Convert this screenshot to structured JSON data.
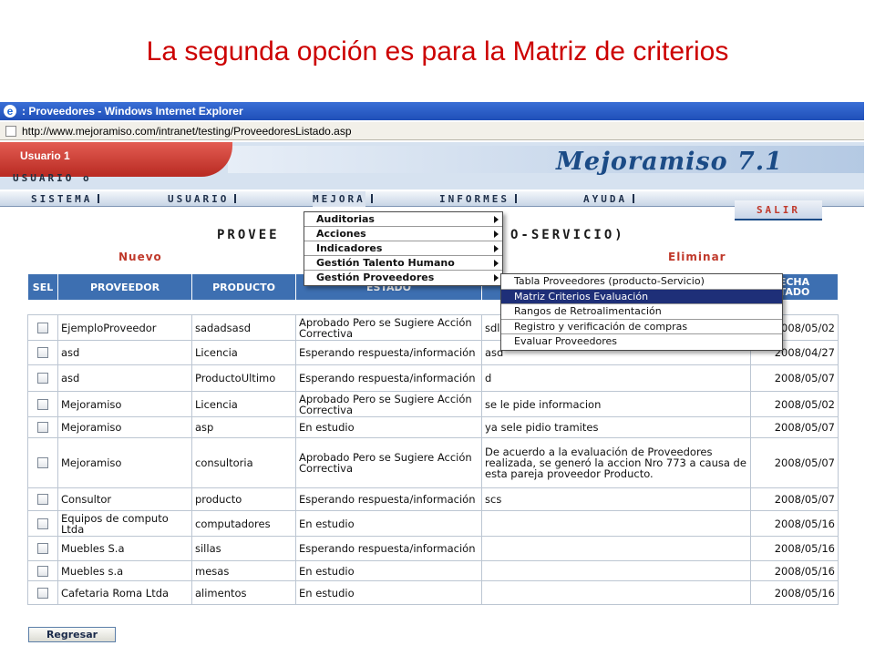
{
  "slide": {
    "title": "La segunda opción es para la Matriz de criterios"
  },
  "browser": {
    "title": ": Proveedores - Windows Internet Explorer",
    "url": "http://www.mejoramiso.com/intranet/testing/ProveedoresListado.asp"
  },
  "app": {
    "user_name": "Usuario 1",
    "user_role": "USUARIO o",
    "brand": "Mejoramiso 7.1",
    "menu": [
      "SISTEMA",
      "USUARIO",
      "MEJORA",
      "INFORMES",
      "AYUDA"
    ],
    "salir": "SALIR"
  },
  "page": {
    "heading_left": "PROVEE",
    "heading_right": "O-SERVICIO)",
    "nuevo": "Nuevo",
    "eliminar": "Eliminar",
    "back_button": "Regresar"
  },
  "dropdown": [
    {
      "label": "Auditorias"
    },
    {
      "label": "Acciones"
    },
    {
      "label": "Indicadores"
    },
    {
      "label": "Gestión Talento Humano"
    },
    {
      "label": "Gestión Proveedores"
    }
  ],
  "submenu": [
    {
      "label": "Tabla Proveedores (producto-Servicio)"
    },
    {
      "label": "Matriz Criterios Evaluación"
    },
    {
      "label": "Rangos de Retroalimentación"
    },
    {
      "label": "Registro y verificación de compras"
    },
    {
      "label": "Evaluar Proveedores"
    }
  ],
  "table": {
    "headers": [
      "SEL",
      "PROVEEDOR",
      "PRODUCTO",
      "ESTADO",
      "",
      "ECHA\nTADO"
    ],
    "rows": [
      {
        "proveedor": "EjemploProveedor",
        "producto": "sadadsasd",
        "estado": "Aprobado Pero se Sugiere Acción Correctiva",
        "obs": "sdl",
        "fecha": "2008/05/02"
      },
      {
        "proveedor": "asd",
        "producto": "Licencia",
        "estado": "Esperando respuesta/información",
        "obs": "asd",
        "fecha": "2008/04/27"
      },
      {
        "proveedor": "asd",
        "producto": "ProductoUltimo",
        "estado": "Esperando respuesta/información",
        "obs": "d",
        "fecha": "2008/05/07"
      },
      {
        "proveedor": "Mejoramiso",
        "producto": "Licencia",
        "estado": "Aprobado Pero se Sugiere Acción Correctiva",
        "obs": "se le pide informacion",
        "fecha": "2008/05/02"
      },
      {
        "proveedor": "Mejoramiso",
        "producto": "asp",
        "estado": "En estudio",
        "obs": "ya sele pidio tramites",
        "fecha": "2008/05/07"
      },
      {
        "proveedor": "Mejoramiso",
        "producto": "consultoria",
        "estado": "Aprobado Pero se Sugiere Acción Correctiva",
        "obs": "De acuerdo a la evaluación de Proveedores realizada, se generó la accion Nro 773 a causa de esta pareja proveedor Producto.",
        "fecha": "2008/05/07"
      },
      {
        "proveedor": "Consultor",
        "producto": "producto",
        "estado": "Esperando respuesta/información",
        "obs": "scs",
        "fecha": "2008/05/07"
      },
      {
        "proveedor": "Equipos de computo Ltda",
        "producto": "computadores",
        "estado": "En estudio",
        "obs": "",
        "fecha": "2008/05/16"
      },
      {
        "proveedor": "Muebles S.a",
        "producto": "sillas",
        "estado": "Esperando respuesta/información",
        "obs": "",
        "fecha": "2008/05/16"
      },
      {
        "proveedor": "Muebles s.a",
        "producto": "mesas",
        "estado": "En estudio",
        "obs": "",
        "fecha": "2008/05/16"
      },
      {
        "proveedor": "Cafetaria Roma Ltda",
        "producto": "alimentos",
        "estado": "En estudio",
        "obs": "",
        "fecha": "2008/05/16"
      }
    ]
  }
}
